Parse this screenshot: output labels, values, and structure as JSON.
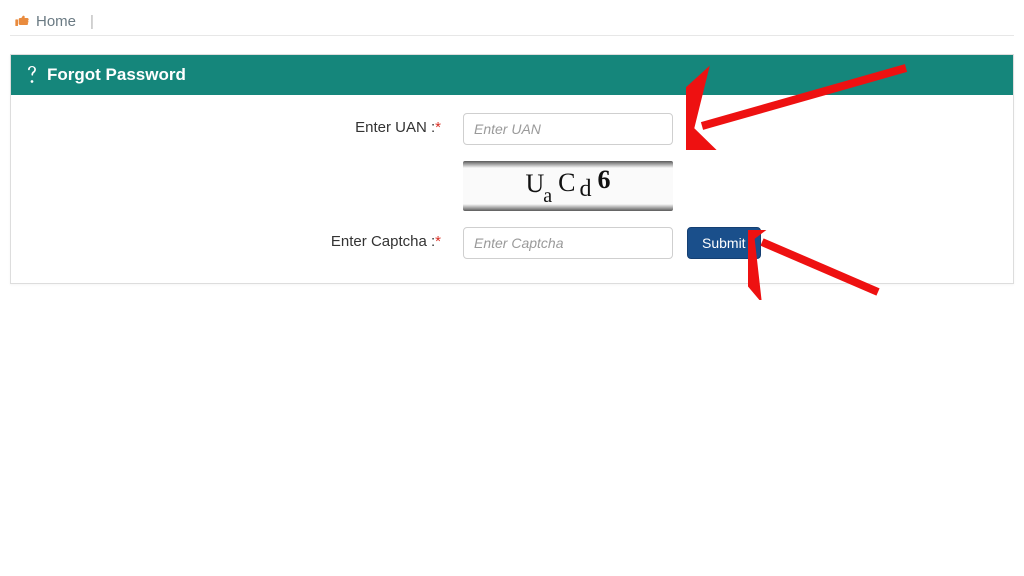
{
  "breadcrumb": {
    "home_label": "Home"
  },
  "panel": {
    "title": "Forgot Password"
  },
  "form": {
    "uan": {
      "label": "Enter UAN :",
      "placeholder": "Enter UAN"
    },
    "captcha_text": {
      "c1": "U",
      "c2": "a",
      "c3": "C",
      "c4": "d",
      "c5": "6"
    },
    "captcha": {
      "label": "Enter Captcha :",
      "placeholder": "Enter Captcha"
    },
    "submit_label": "Submit"
  }
}
